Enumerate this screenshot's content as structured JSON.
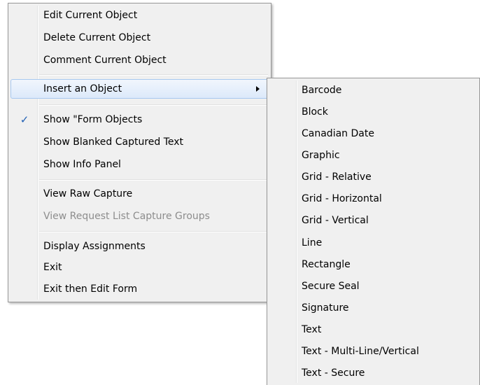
{
  "main_menu": {
    "items": [
      {
        "label": "Edit Current Object"
      },
      {
        "label": "Delete Current Object"
      },
      {
        "label": "Comment Current Object"
      },
      {
        "label": "Insert an Object",
        "has_submenu": true,
        "highlighted": true
      },
      {
        "label": "Show \"Form Objects",
        "checked": true
      },
      {
        "label": "Show Blanked Captured Text"
      },
      {
        "label": "Show Info Panel"
      },
      {
        "label": "View Raw Capture"
      },
      {
        "label": "View Request List Capture Groups",
        "disabled": true
      },
      {
        "label": "Display Assignments"
      },
      {
        "label": "Exit"
      },
      {
        "label": "Exit then Edit Form"
      }
    ],
    "check_glyph": "✓"
  },
  "sub_menu": {
    "items": [
      {
        "label": "Barcode"
      },
      {
        "label": "Block"
      },
      {
        "label": "Canadian Date"
      },
      {
        "label": "Graphic"
      },
      {
        "label": "Grid - Relative"
      },
      {
        "label": "Grid - Horizontal"
      },
      {
        "label": "Grid - Vertical"
      },
      {
        "label": "Line"
      },
      {
        "label": "Rectangle"
      },
      {
        "label": "Secure Seal"
      },
      {
        "label": "Signature"
      },
      {
        "label": "Text"
      },
      {
        "label": "Text - Multi-Line/Vertical"
      },
      {
        "label": "Text - Secure"
      }
    ]
  },
  "colors": {
    "menu_background": "#f0f0f0",
    "highlight_border": "#a8c8ef",
    "check_color": "#1f5fb4",
    "disabled_text": "#8d8d8d"
  },
  "icons": {
    "check": "check-icon",
    "submenu_arrow": "submenu-arrow-icon"
  }
}
